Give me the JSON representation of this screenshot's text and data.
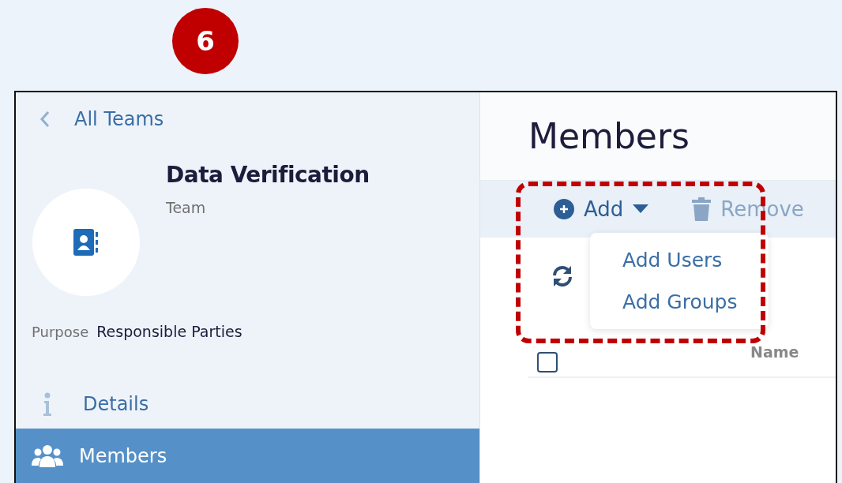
{
  "step_badge": "6",
  "sidebar": {
    "back_link": "All Teams",
    "team": {
      "name": "Data Verification",
      "type": "Team"
    },
    "purpose": {
      "label": "Purpose",
      "value": "Responsible Parties"
    },
    "items": [
      {
        "label": "Details",
        "kind": "info",
        "selected": false
      },
      {
        "label": "Members",
        "kind": "people",
        "selected": true
      }
    ]
  },
  "main": {
    "title": "Members",
    "toolbar": [
      {
        "label": "Add",
        "kind": "add",
        "disabled": false
      },
      {
        "label": "Remove",
        "kind": "remove",
        "disabled": true
      }
    ],
    "add_menu": {
      "items": [
        "Add Users",
        "Add Groups"
      ]
    },
    "table": {
      "select_all_checked": false,
      "columns": [
        "Name"
      ]
    }
  }
}
